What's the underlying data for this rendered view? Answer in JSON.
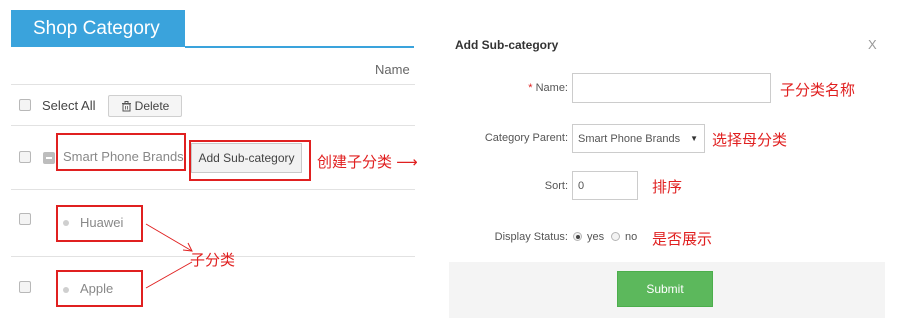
{
  "shop_tab": {
    "title": "Shop Category"
  },
  "table": {
    "column_header": "Name"
  },
  "toolbar": {
    "select_all_label": "Select All",
    "delete_label": "Delete",
    "delete_icon": "trash-icon"
  },
  "categories": [
    {
      "name": "Smart Phone Brands",
      "action_label": "Add Sub-category",
      "children": [
        {
          "name": "Huawei"
        },
        {
          "name": "Apple"
        }
      ]
    }
  ],
  "annotations": {
    "create_sub": "创建子分类 ⟶",
    "sub_category": "子分类",
    "name_hint": "子分类名称",
    "parent_hint": "选择母分类",
    "sort_hint": "排序",
    "display_hint": "是否展示"
  },
  "modal": {
    "title": "Add Sub-category",
    "close_label": "X",
    "fields": {
      "name": {
        "label": "Name:",
        "required_marker": "*",
        "value": ""
      },
      "parent": {
        "label": "Category Parent:",
        "value": "Smart Phone Brands"
      },
      "sort": {
        "label": "Sort:",
        "value": "0"
      },
      "display_status": {
        "label": "Display Status:",
        "yes_label": "yes",
        "no_label": "no",
        "selected": "yes"
      }
    },
    "submit_label": "Submit"
  },
  "colors": {
    "accent": "#3aa3dc",
    "annotation": "#e02020",
    "submit": "#5cb85c"
  }
}
